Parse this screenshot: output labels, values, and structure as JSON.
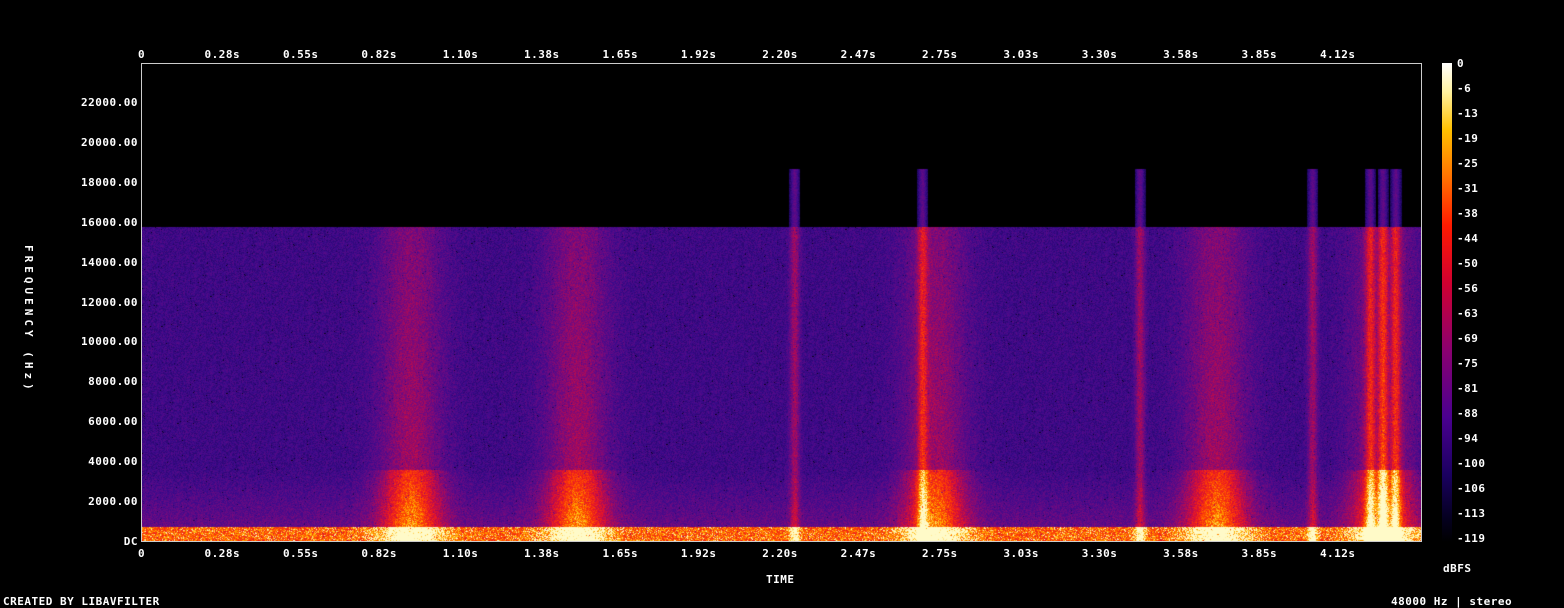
{
  "footer": {
    "credit": "CREATED BY LIBAVFILTER",
    "info": "48000 Hz | stereo"
  },
  "chart_data": {
    "type": "heatmap",
    "title": "",
    "xlabel": "TIME",
    "ylabel": "FREQUENCY (Hz)",
    "colorbar_label": "dBFS",
    "x_ticks": [
      "0",
      "0.28s",
      "0.55s",
      "0.82s",
      "1.10s",
      "1.38s",
      "1.65s",
      "1.92s",
      "2.20s",
      "2.47s",
      "2.75s",
      "3.03s",
      "3.30s",
      "3.58s",
      "3.85s",
      "4.12s"
    ],
    "x_tick_values": [
      0,
      0.28,
      0.55,
      0.82,
      1.1,
      1.38,
      1.65,
      1.92,
      2.2,
      2.47,
      2.75,
      3.03,
      3.3,
      3.58,
      3.85,
      4.12
    ],
    "xlim": [
      0,
      4.41
    ],
    "y_ticks": [
      "DC",
      "2000.00",
      "4000.00",
      "6000.00",
      "8000.00",
      "10000.00",
      "12000.00",
      "14000.00",
      "16000.00",
      "18000.00",
      "20000.00",
      "22000.00"
    ],
    "y_tick_values": [
      0,
      2000,
      4000,
      6000,
      8000,
      10000,
      12000,
      14000,
      16000,
      18000,
      20000,
      22000
    ],
    "ylim": [
      0,
      24000
    ],
    "colorbar_ticks": [
      "0",
      "-6",
      "-13",
      "-19",
      "-25",
      "-31",
      "-38",
      "-44",
      "-50",
      "-56",
      "-63",
      "-69",
      "-75",
      "-81",
      "-88",
      "-94",
      "-100",
      "-106",
      "-113",
      "-119"
    ],
    "color_range_dbfs": [
      -119,
      0
    ],
    "bandwidth_cutoff_hz": 15800,
    "grid": false,
    "colors": {
      "background": "#000000",
      "low": "#1a0060",
      "mid": "#8a0070",
      "high": "#ff1a00",
      "peak": "#fff2a0"
    }
  }
}
